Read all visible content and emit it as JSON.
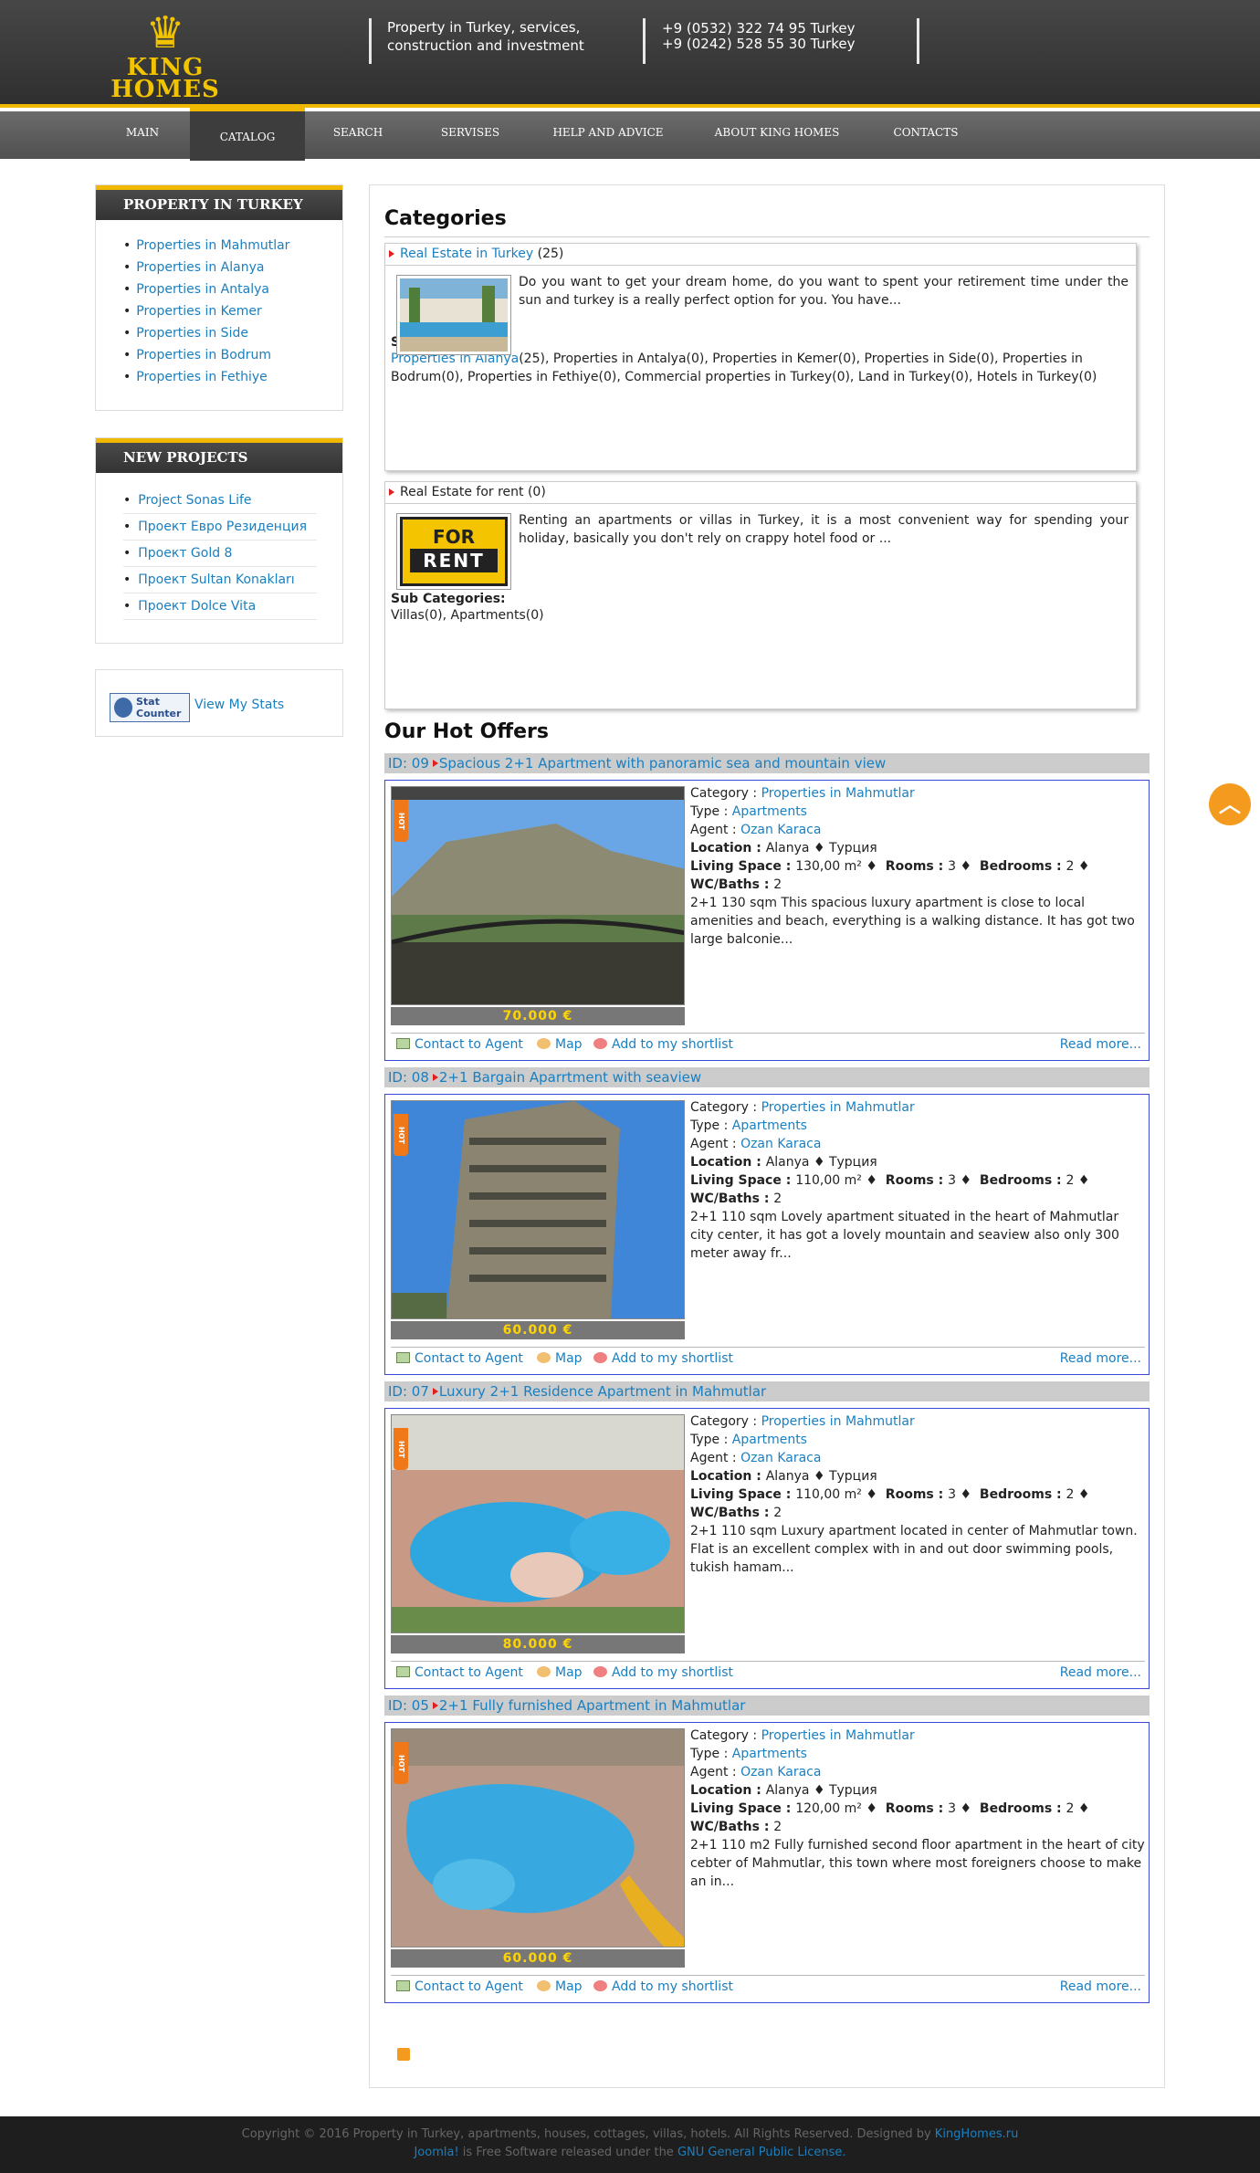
{
  "header": {
    "logo_line1": "KING",
    "logo_line2": "HOMES",
    "tagline": "Property in Turkey, services, construction and investment",
    "phone1": "+9 (0532) 322 74 95 Turkey",
    "phone2": "+9 (0242) 528 55 30  Turkey"
  },
  "nav": [
    "MAIN",
    "CATALOG",
    "SEARCH",
    "SERVISES",
    "HELP AND ADVICE",
    "ABOUT KING HOMES",
    "CONTACTS"
  ],
  "sidebar": {
    "property": {
      "title": "PROPERTY IN TURKEY",
      "items": [
        "Properties in Mahmutlar",
        "Properties in Alanya",
        "Properties in Antalya",
        "Properties in Kemer",
        "Properties in Side",
        "Properties in Bodrum",
        "Properties in Fethiye"
      ]
    },
    "projects": {
      "title": "NEW PROJECTS",
      "items": [
        "Project Sonas Life",
        "Проект Евро Резиденция",
        "Проект Gold 8",
        "Проект Sultan Konakları",
        "Проект Dolce Vita"
      ]
    },
    "stats": {
      "badge1": "Stat",
      "badge2": "Counter",
      "link": "View My Stats"
    }
  },
  "main": {
    "categories_title": "Categories",
    "cat1": {
      "title": "Real Estate in Turkey",
      "count": " (25)",
      "desc": "Do you want to get your dream home, do you want to spent your retirement time under the sun and turkey is a really perfect option for you. You have...",
      "sub_label": "Sub Categories:",
      "sub_first": "Properties in Alanya",
      "sub_rest": "(25),  Properties in Antalya(0),  Properties in Kemer(0),  Properties in Side(0),  Properties in Bodrum(0),  Properties in Fethiye(0),  Commercial properties in Turkey(0),  Land in Turkey(0),  Hotels in Turkey(0)"
    },
    "cat2": {
      "title": "Real Estate for rent (0)",
      "sign1": "FOR",
      "sign2": "RENT",
      "desc": "Renting an apartments or villas in Turkey, it is a most convenient way for spending your holiday, basically you don't rely on crappy hotel food or ...",
      "sub_label": "Sub Categories:",
      "sub_list": "Villas(0),  Apartments(0)"
    },
    "hot_title": "Our Hot Offers",
    "labels": {
      "category": "Category : ",
      "type": "Type : ",
      "agent": "Agent : ",
      "location": "Location : ",
      "living": "Living Space : ",
      "rooms": "Rooms : ",
      "bedrooms": "Bedrooms : ",
      "wc": "WC/Baths : ",
      "hot": "HOT",
      "contact": "Contact to Agent",
      "map": "Map",
      "shortlist": "Add to my shortlist",
      "read_more": "Read more..."
    },
    "offers": [
      {
        "id": "ID: 09",
        "title": "Spacious 2+1 Apartment with panoramic sea and mountain view",
        "price": "70.000 €",
        "category": "Properties in Mahmutlar",
        "type": "Apartments",
        "agent": "Ozan Karaca",
        "location": "Alanya ♦ Турция",
        "living": "130,00 m² ♦",
        "rooms": "3 ♦",
        "bedrooms": "2 ♦",
        "wc": "2",
        "desc": "2+1 130 sqm This spacious luxury apartment is close to local amenities and beach, everything is a walking distance. It has got two large balconie..."
      },
      {
        "id": "ID: 08",
        "title": "2+1 Bargain Aparrtment with seaview",
        "price": "60.000 €",
        "category": "Properties in Mahmutlar",
        "type": "Apartments",
        "agent": "Ozan Karaca",
        "location": "Alanya ♦ Турция",
        "living": "110,00 m² ♦",
        "rooms": "3 ♦",
        "bedrooms": "2 ♦",
        "wc": "2",
        "desc": "2+1 110 sqm Lovely apartment situated in the heart of Mahmutlar city center, it has got a lovely mountain and seaview also only 300 meter away fr..."
      },
      {
        "id": "ID: 07",
        "title": "Luxury 2+1 Residence Apartment in Mahmutlar",
        "price": "80.000 €",
        "category": "Properties in Mahmutlar",
        "type": "Apartments",
        "agent": "Ozan Karaca",
        "location": "Alanya ♦ Турция",
        "living": "110,00 m² ♦",
        "rooms": "3 ♦",
        "bedrooms": "2 ♦",
        "wc": "2",
        "desc": "2+1 110 sqm Luxury apartment located in center of Mahmutlar town. Flat is an excellent complex with in and out door swimming pools, tukish hamam..."
      },
      {
        "id": "ID: 05",
        "title": "2+1 Fully furnished Apartment in Mahmutlar",
        "price": "60.000 €",
        "category": "Properties in Mahmutlar",
        "type": "Apartments",
        "agent": "Ozan Karaca",
        "location": "Alanya ♦ Турция",
        "living": "120,00 m² ♦",
        "rooms": "3 ♦",
        "bedrooms": "2 ♦",
        "wc": "2",
        "desc": "2+1  110 m2 Fully furnished second floor apartment in the heart of city cebter of Mahmutlar, this town where most foreigners choose to make an in..."
      }
    ]
  },
  "footer": {
    "copyright": "Copyright © 2016 Property in Turkey, apartments, houses, cottages, villas, hotels. All Rights Reserved. Designed by ",
    "designer": "KingHomes.ru",
    "joomla": "Joomla!",
    "license_text": " is Free Software released under the ",
    "license": "GNU General Public License."
  },
  "icons": {
    "logo": "crown-icon",
    "to_top": "chevron-up-icon",
    "rss": "rss-icon",
    "contact": "mail-icon",
    "map": "map-icon",
    "shortlist": "heart-icon"
  },
  "colors": {
    "accent": "#f0b800",
    "link": "#1a7fc0",
    "price": "#ffd400",
    "hot": "#f07818"
  }
}
